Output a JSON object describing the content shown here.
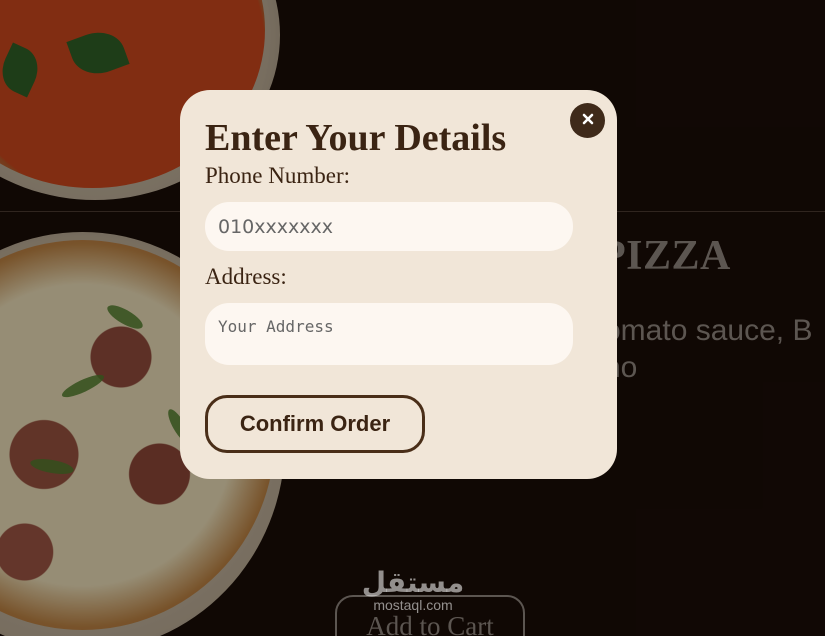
{
  "background": {
    "product_title": "PIZZA",
    "product_description": "omato sauce, B no",
    "add_to_cart_label": "Add to Cart"
  },
  "watermark": {
    "logo_text": "مستقل",
    "url_text": "mostaql.com"
  },
  "modal": {
    "title": "Enter Your Details",
    "close_icon": "close-icon",
    "phone_label": "Phone Number:",
    "phone_placeholder": "010xxxxxxx",
    "phone_value": "",
    "address_label": "Address:",
    "address_placeholder": "Your Address",
    "address_value": "",
    "confirm_label": "Confirm Order"
  },
  "colors": {
    "page_background": "#1a0d07",
    "modal_background": "#f1e6d8",
    "input_background": "#fdf7f1",
    "accent_brown": "#3f2a1a",
    "text_dark": "#3b2413"
  }
}
